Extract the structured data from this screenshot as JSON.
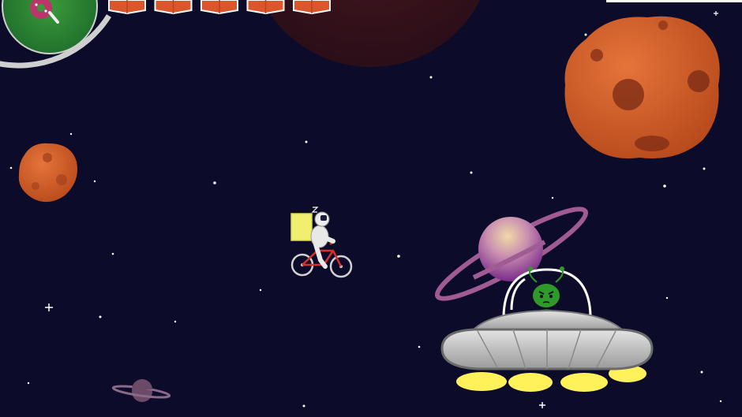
{
  "hud": {
    "boxes_total": 5,
    "boxes_remaining": 5,
    "health_fraction": 1.0,
    "minimap_icon": "donut-icon"
  },
  "player": {
    "character": "astronaut",
    "vehicle": "bicycle",
    "cargo": "delivery-box-icon"
  },
  "enemies": [
    {
      "type": "ufo",
      "pilot": "green-alien"
    }
  ],
  "scenery": {
    "asteroids": 2,
    "planets": [
      "ringed-planet-large",
      "ringed-planet-small",
      "red-planet"
    ]
  },
  "colors": {
    "space": "#0c0b2a",
    "box": "#d9572a",
    "box_border": "#ffffff",
    "asteroid": "#d9652d",
    "alien": "#2f9a2a",
    "ufo_body": "#c9c9c9",
    "ufo_lights": "#fff15a",
    "ring": "#a05c92"
  }
}
